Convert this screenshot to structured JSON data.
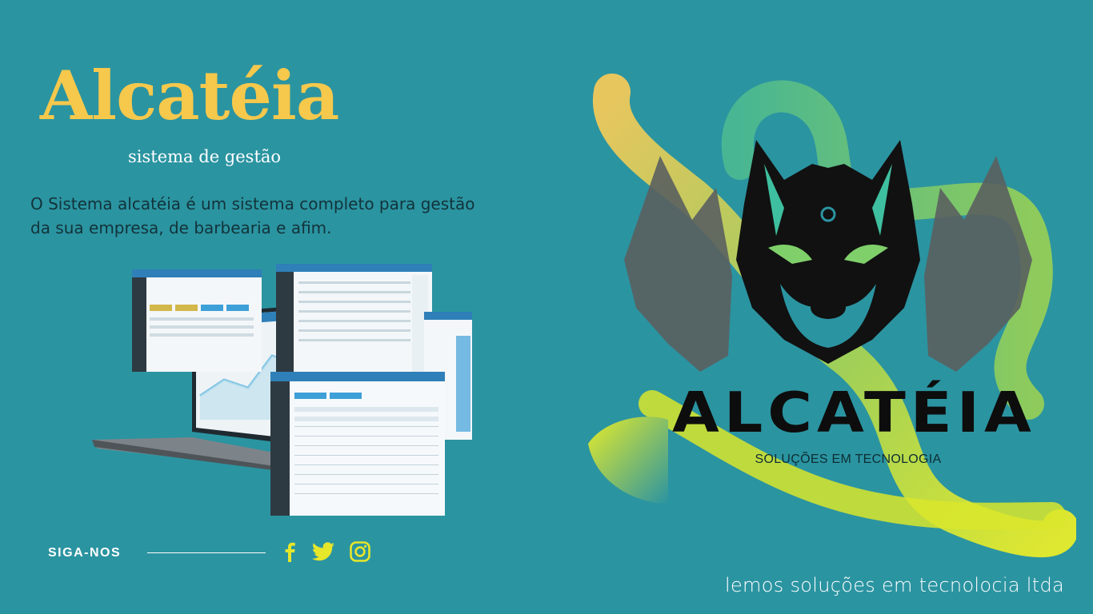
{
  "header": {
    "title": "Alcatéia",
    "subtitle": "sistema de gestão"
  },
  "description": {
    "line1": "O Sistema alcatéia é um sistema completo para gestão",
    "line2": "da sua empresa,  de barbearia e afim."
  },
  "social": {
    "label": "SIGA-NOS",
    "icons": [
      "facebook-icon",
      "twitter-icon",
      "instagram-icon"
    ]
  },
  "logo": {
    "wordmark": "ALCATÉIA",
    "tagline": "SOLUÇÕES EM TECNOLOGIA"
  },
  "footer": {
    "company": "lemos soluções em tecnolocia ltda"
  },
  "colors": {
    "background": "#2b94a1",
    "title": "#f6c84c",
    "accent_yellow": "#e6e62a",
    "accent_green": "#6fcf5a"
  }
}
